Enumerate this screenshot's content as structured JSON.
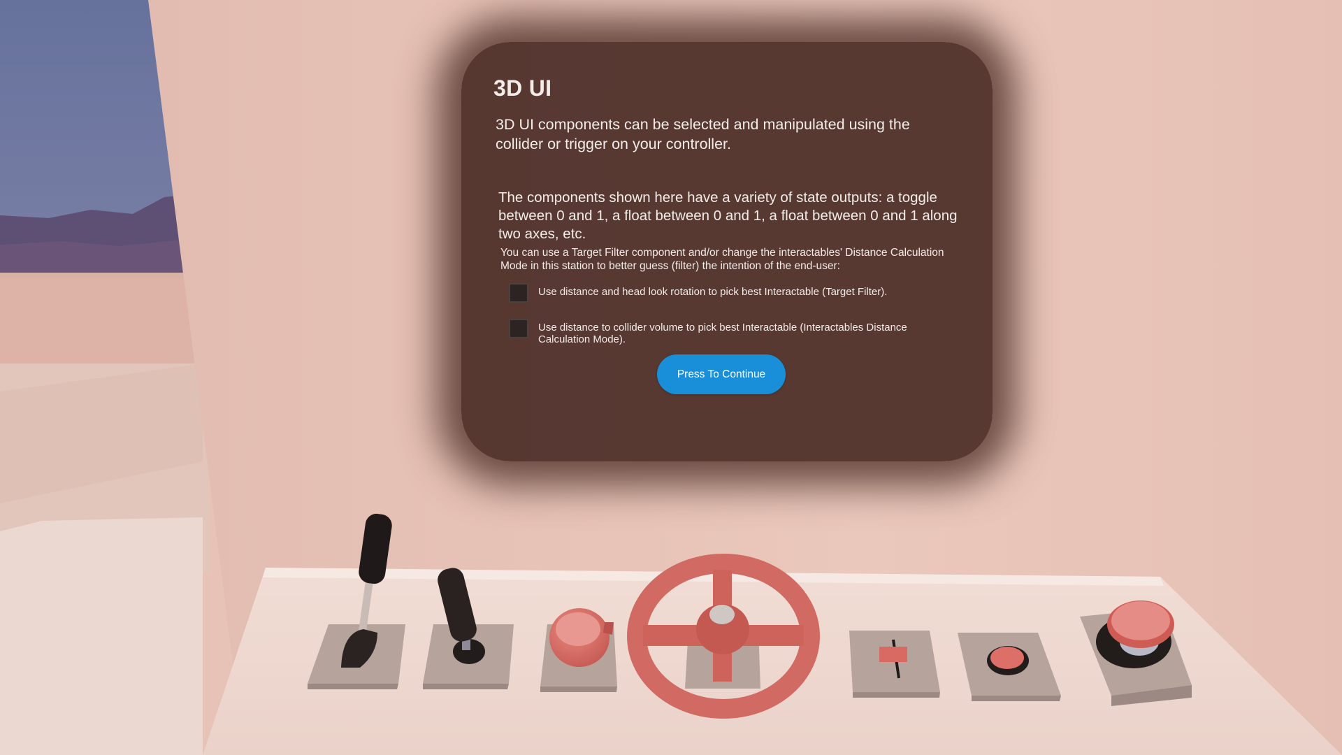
{
  "panel": {
    "title": "3D UI",
    "intro": "3D UI components can be selected and manipulated using the collider or trigger on your controller.",
    "body": "The components shown here have a variety of state outputs: a toggle between 0 and 1, a float between 0 and 1, a float between 0 and 1 along two axes, etc.",
    "note": "You can use a Target Filter component and/or change the interactables' Distance Calculation Mode in this station to better guess (filter) the intention of the end-user:",
    "options": [
      {
        "label": "Use distance and head look rotation to pick best Interactable (Target Filter).",
        "checked": false
      },
      {
        "label": "Use distance to collider volume to pick best Interactable (Interactables Distance Calculation Mode).",
        "checked": false
      }
    ],
    "continue_label": "Press To Continue"
  },
  "controls": [
    "lever",
    "joystick",
    "knob",
    "steering-wheel",
    "slider",
    "push-button",
    "big-button"
  ],
  "colors": {
    "wall": "#e7c2b6",
    "panel_background": "#4b2d26",
    "button_accent": "#1a8fd9",
    "control_red": "#d16a62",
    "sky": "#6b76a0"
  }
}
